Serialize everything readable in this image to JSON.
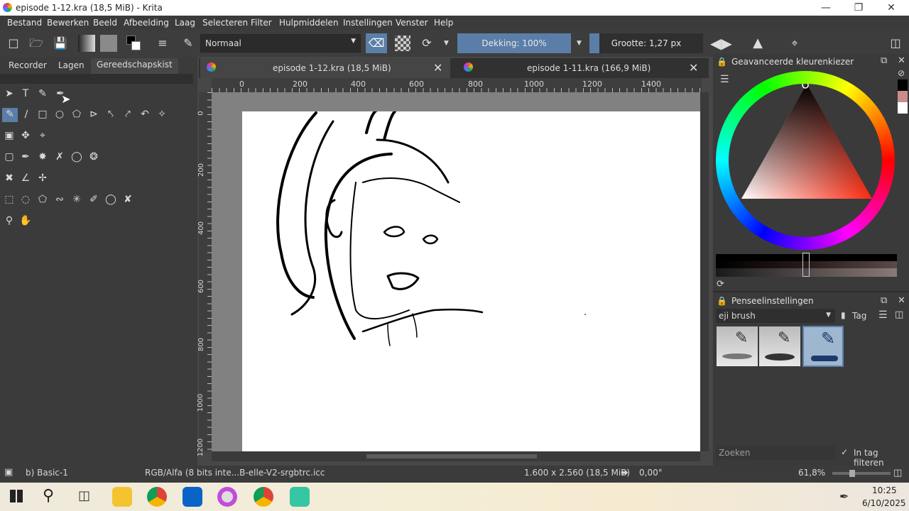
{
  "window": {
    "title": "episode 1-12.kra (18,5 MiB)  - Krita",
    "controls": {
      "minimize": "—",
      "maximize": "❐",
      "close": "✕"
    }
  },
  "menu": [
    "Bestand",
    "Bewerken",
    "Beeld",
    "Afbeelding",
    "Laag",
    "Selecteren",
    "Filter",
    "Hulpmiddelen",
    "Instellingen",
    "Venster",
    "Help"
  ],
  "toolbar": {
    "blend_mode": "Normaal",
    "opacity_label": "Dekking: 100%",
    "size_label": "Grootte: 1,27 px"
  },
  "left_dock": {
    "tabs": [
      "Recorder",
      "Lagen",
      "Gereedschapskist"
    ],
    "active_tab": "Gereedschapskist"
  },
  "document_tabs": [
    {
      "label": "episode 1-12.kra (18,5 MiB)",
      "active": true
    },
    {
      "label": "episode 1-11.kra (166,9 MiB)",
      "active": false
    }
  ],
  "rulers": {
    "horizontal": [
      "0",
      "200",
      "400",
      "600",
      "800",
      "1000",
      "1200",
      "1400"
    ],
    "vertical": [
      "0",
      "200",
      "400",
      "600",
      "800",
      "1000",
      "1200"
    ]
  },
  "color_selector": {
    "title": "Geavanceerde kleurenkiezer",
    "colors": {
      "fg": "#000000",
      "swatch1": "#c98d8a",
      "swatch2": "#ffffff"
    }
  },
  "brush_settings": {
    "title": "Penseelinstellingen",
    "preset": "eji brush",
    "tag_label": "Tag",
    "search_placeholder": "Zoeken",
    "filter_label": "In tag filteren"
  },
  "status": {
    "brush": "b) Basic-1",
    "colorspace": "RGB/Alfa (8 bits inte...B-elle-V2-srgbtrc.icc",
    "dimensions": "1.600 x 2.560 (18,5 MiB)",
    "rotation": "0,00°",
    "zoom": "61,8%"
  },
  "taskbar": {
    "time": "10:25",
    "date": "6/10/2025"
  }
}
